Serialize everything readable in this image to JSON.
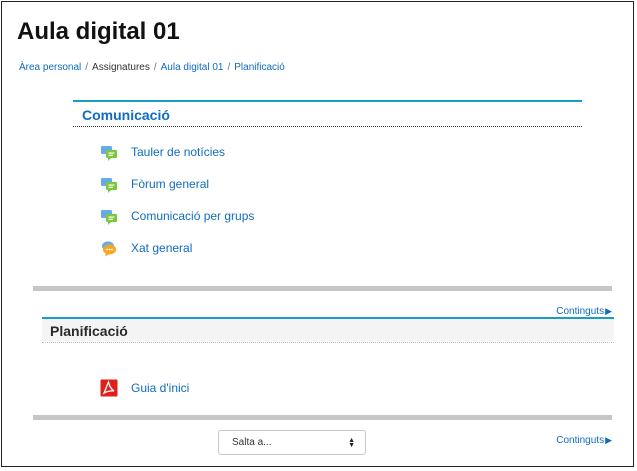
{
  "page": {
    "title": "Aula digital 01"
  },
  "breadcrumb": {
    "items": [
      {
        "label": "Àrea personal",
        "link": true
      },
      {
        "label": "Assignatures",
        "link": false
      },
      {
        "label": "Aula digital 01",
        "link": true
      },
      {
        "label": "Planificació",
        "link": true
      }
    ],
    "separator": "/"
  },
  "sections": [
    {
      "title": "Comunicació",
      "activities": [
        {
          "label": "Tauler de notícies",
          "icon": "forum-icon"
        },
        {
          "label": "Fòrum general",
          "icon": "forum-icon"
        },
        {
          "label": "Comunicació per grups",
          "icon": "forum-icon"
        },
        {
          "label": "Xat general",
          "icon": "chat-icon"
        }
      ],
      "contents_link": "Continguts"
    },
    {
      "title": "Planificació",
      "activities": [
        {
          "label": "Guia d'inici",
          "icon": "pdf-icon"
        }
      ],
      "contents_link": "Continguts"
    }
  ],
  "jump_to": {
    "selected": "Salta a..."
  },
  "colors": {
    "link": "#0f6cbf",
    "section_border": "#1a9dc4",
    "separator": "#c6c6c6",
    "pdf_red": "#e0201b",
    "forum_blue": "#6aa9e9",
    "forum_green": "#7cc63d",
    "chat_orange": "#f5a623"
  }
}
